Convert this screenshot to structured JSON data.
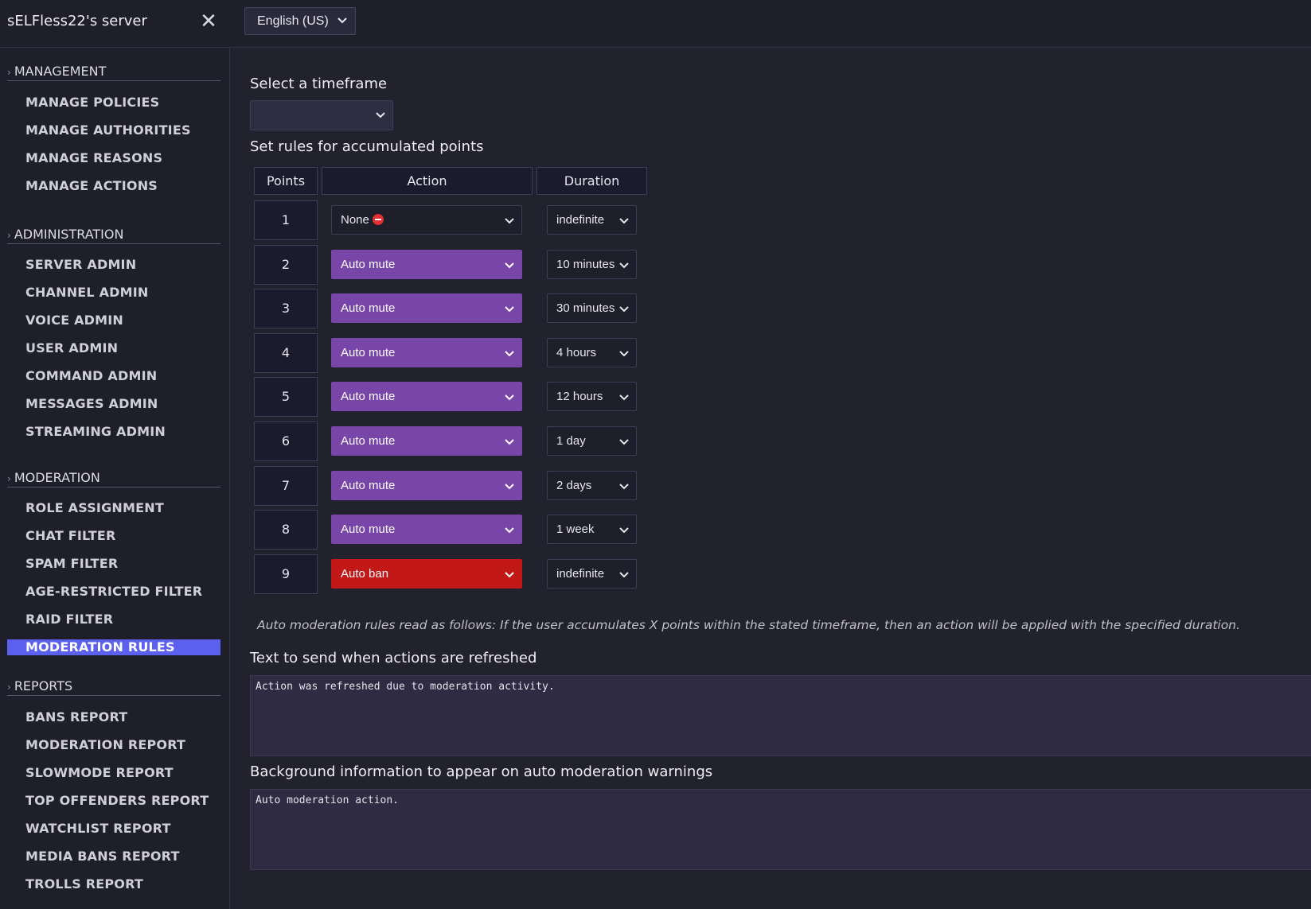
{
  "header": {
    "server_title": "sELFless22's server",
    "language": "English (US)"
  },
  "sidebar": {
    "sections": [
      {
        "label": "MANAGEMENT",
        "items": [
          "MANAGE POLICIES",
          "MANAGE AUTHORITIES",
          "MANAGE REASONS",
          "MANAGE ACTIONS"
        ]
      },
      {
        "label": "ADMINISTRATION",
        "items": [
          "SERVER ADMIN",
          "CHANNEL ADMIN",
          "VOICE ADMIN",
          "USER ADMIN",
          "COMMAND ADMIN",
          "MESSAGES ADMIN",
          "STREAMING ADMIN"
        ]
      },
      {
        "label": "MODERATION",
        "items": [
          "ROLE ASSIGNMENT",
          "CHAT FILTER",
          "SPAM FILTER",
          "AGE-RESTRICTED FILTER",
          "RAID FILTER",
          "MODERATION RULES"
        ]
      },
      {
        "label": "REPORTS",
        "items": [
          "BANS REPORT",
          "MODERATION REPORT",
          "SLOWMODE REPORT",
          "TOP OFFENDERS REPORT",
          "WATCHLIST REPORT",
          "MEDIA BANS REPORT",
          "TROLLS REPORT"
        ]
      }
    ],
    "active_item": "MODERATION RULES"
  },
  "main": {
    "timeframe_label": "Select a timeframe",
    "timeframe_value": "",
    "rules_label": "Set rules for accumulated points",
    "table_headers": {
      "points": "Points",
      "action": "Action",
      "duration": "Duration"
    },
    "rules": [
      {
        "points": "1",
        "action": "None",
        "duration": "indefinite"
      },
      {
        "points": "2",
        "action": "Auto mute",
        "duration": "10 minutes"
      },
      {
        "points": "3",
        "action": "Auto mute",
        "duration": "30 minutes"
      },
      {
        "points": "4",
        "action": "Auto mute",
        "duration": "4 hours"
      },
      {
        "points": "5",
        "action": "Auto mute",
        "duration": "12 hours"
      },
      {
        "points": "6",
        "action": "Auto mute",
        "duration": "1 day"
      },
      {
        "points": "7",
        "action": "Auto mute",
        "duration": "2 days"
      },
      {
        "points": "8",
        "action": "Auto mute",
        "duration": "1 week"
      },
      {
        "points": "9",
        "action": "Auto ban",
        "duration": "indefinite"
      }
    ],
    "hint": "Auto moderation rules read as follows: If the user accumulates X points within the stated timeframe, then an action will be applied with the specified duration.",
    "refresh_label": "Text to send when actions are refreshed",
    "refresh_text": "Action was refreshed due to moderation activity.",
    "background_label": "Background information to appear on auto moderation warnings",
    "background_text": "Auto moderation action."
  },
  "colors": {
    "accent_active": "#5b61ee",
    "auto_mute": "#7846a8",
    "auto_ban": "#c21818",
    "none_icon": "#e03030"
  },
  "icons": {
    "close": "close-icon",
    "dropdown": "chevron-down-icon",
    "section_arrow": "chevron-right-icon",
    "none_action": "no-entry-icon"
  }
}
